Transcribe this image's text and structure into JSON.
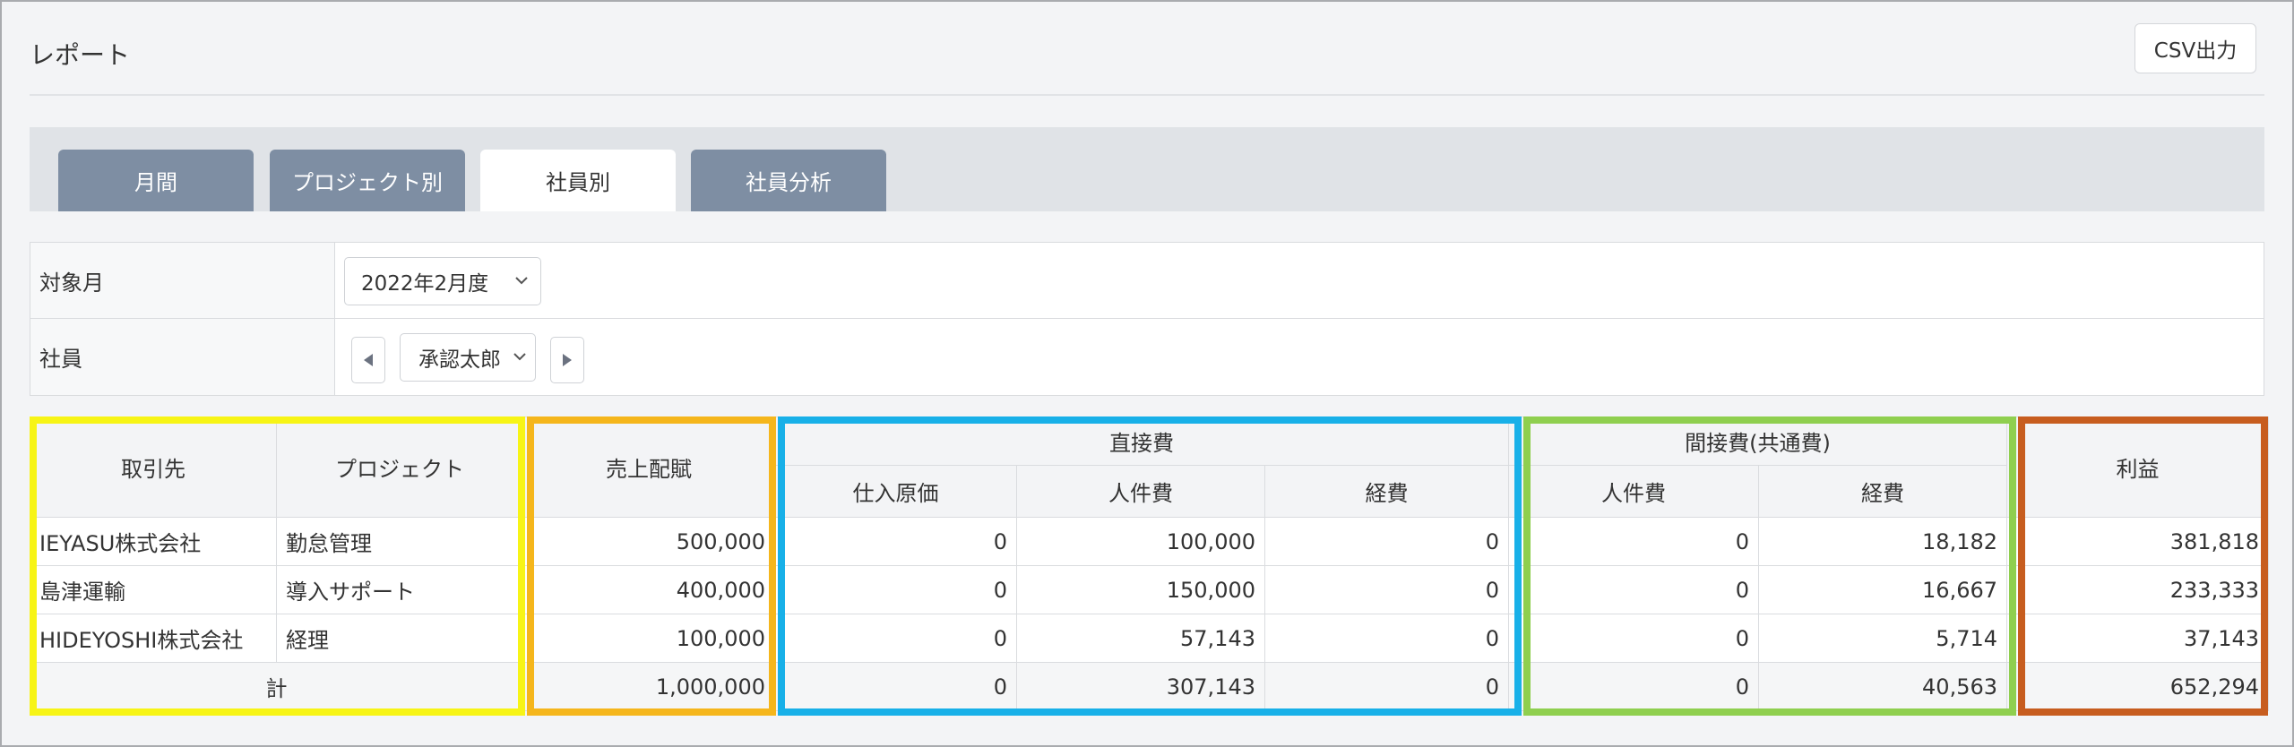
{
  "page": {
    "title": "レポート",
    "csv_button": "CSV出力"
  },
  "tabs": [
    {
      "label": "月間",
      "active": false
    },
    {
      "label": "プロジェクト別",
      "active": false
    },
    {
      "label": "社員別",
      "active": true
    },
    {
      "label": "社員分析",
      "active": false
    }
  ],
  "filters": {
    "month_label": "対象月",
    "month_value": "2022年2月度",
    "employee_label": "社員",
    "employee_value": "承認太郎"
  },
  "table": {
    "headers": {
      "client": "取引先",
      "project": "プロジェクト",
      "sales": "売上配賦",
      "direct": "直接費",
      "direct_purchase": "仕入原価",
      "direct_labor": "人件費",
      "direct_expense": "経費",
      "indirect": "間接費(共通費)",
      "indirect_labor": "人件費",
      "indirect_expense": "経費",
      "profit": "利益"
    },
    "rows": [
      {
        "client": "IEYASU株式会社",
        "project": "勤怠管理",
        "sales": "500,000",
        "purchase": "0",
        "labor": "100,000",
        "expense": "0",
        "ind_labor": "0",
        "ind_expense": "18,182",
        "profit": "381,818"
      },
      {
        "client": "島津運輸",
        "project": "導入サポート",
        "sales": "400,000",
        "purchase": "0",
        "labor": "150,000",
        "expense": "0",
        "ind_labor": "0",
        "ind_expense": "16,667",
        "profit": "233,333"
      },
      {
        "client": "HIDEYOSHI株式会社",
        "project": "経理",
        "sales": "100,000",
        "purchase": "0",
        "labor": "57,143",
        "expense": "0",
        "ind_labor": "0",
        "ind_expense": "5,714",
        "profit": "37,143"
      }
    ],
    "total": {
      "label": "計",
      "sales": "1,000,000",
      "purchase": "0",
      "labor": "307,143",
      "expense": "0",
      "ind_labor": "0",
      "ind_expense": "40,563",
      "profit": "652,294"
    }
  },
  "highlight_colors": {
    "client_project": "#f7f416",
    "sales": "#f5b61c",
    "direct_costs": "#18b0e8",
    "indirect_costs": "#8fcf4f",
    "profit": "#c75d1f"
  },
  "icons": {
    "month_dropdown": "chevron-down-icon",
    "employee_dropdown": "chevron-down-icon",
    "prev_employee": "triangle-left-icon",
    "next_employee": "triangle-right-icon"
  }
}
